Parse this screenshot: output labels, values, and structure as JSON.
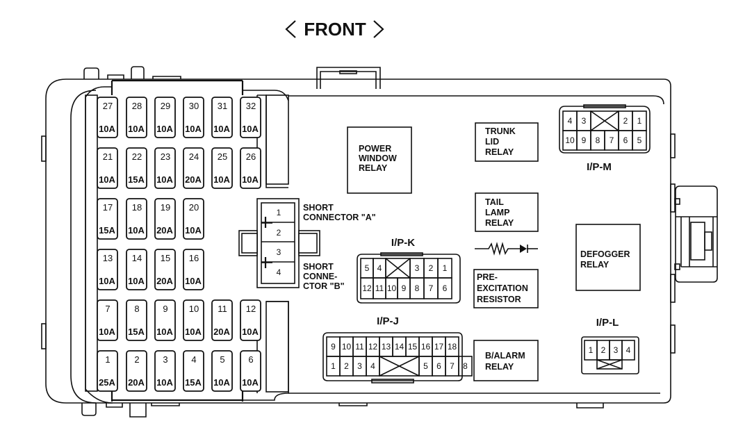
{
  "title": "FRONT",
  "fuses": [
    {
      "num": "27",
      "amp": "10A"
    },
    {
      "num": "28",
      "amp": "10A"
    },
    {
      "num": "29",
      "amp": "10A"
    },
    {
      "num": "30",
      "amp": "10A"
    },
    {
      "num": "31",
      "amp": "10A"
    },
    {
      "num": "32",
      "amp": "10A"
    },
    {
      "num": "21",
      "amp": "10A"
    },
    {
      "num": "22",
      "amp": "15A"
    },
    {
      "num": "23",
      "amp": "10A"
    },
    {
      "num": "24",
      "amp": "20A"
    },
    {
      "num": "25",
      "amp": "10A"
    },
    {
      "num": "26",
      "amp": "10A"
    },
    {
      "num": "17",
      "amp": "15A"
    },
    {
      "num": "18",
      "amp": "10A"
    },
    {
      "num": "19",
      "amp": "20A"
    },
    {
      "num": "20",
      "amp": "10A"
    },
    {
      "num": "13",
      "amp": "10A"
    },
    {
      "num": "14",
      "amp": "10A"
    },
    {
      "num": "15",
      "amp": "20A"
    },
    {
      "num": "16",
      "amp": "10A"
    },
    {
      "num": "7",
      "amp": "10A"
    },
    {
      "num": "8",
      "amp": "15A"
    },
    {
      "num": "9",
      "amp": "10A"
    },
    {
      "num": "10",
      "amp": "10A"
    },
    {
      "num": "11",
      "amp": "20A"
    },
    {
      "num": "12",
      "amp": "10A"
    },
    {
      "num": "1",
      "amp": "25A"
    },
    {
      "num": "2",
      "amp": "20A"
    },
    {
      "num": "3",
      "amp": "10A"
    },
    {
      "num": "4",
      "amp": "15A"
    },
    {
      "num": "5",
      "amp": "10A"
    },
    {
      "num": "6",
      "amp": "10A"
    }
  ],
  "short_connector": {
    "pins": [
      "1",
      "2",
      "3",
      "4"
    ],
    "label_a": [
      "SHORT",
      "CONNECTOR \"A\""
    ],
    "label_b": [
      "SHORT",
      "CONNE-",
      "CTOR \"B\""
    ]
  },
  "relays": {
    "power_window": [
      "POWER",
      "WINDOW",
      "RELAY"
    ],
    "trunk_lid": [
      "TRUNK",
      "LID",
      "RELAY"
    ],
    "tail_lamp": [
      "TAIL",
      "LAMP",
      "RELAY"
    ],
    "pre_excitation": [
      "PRE-",
      "EXCITATION",
      "RESISTOR"
    ],
    "b_alarm": [
      "B/ALARM",
      "RELAY"
    ],
    "defogger": [
      "DEFOGGER",
      "RELAY"
    ]
  },
  "connectors": {
    "ip_k": {
      "name": "I/P-K",
      "top": [
        "5",
        "4",
        "",
        "3",
        "2",
        "1"
      ],
      "bottom": [
        "12",
        "11",
        "10",
        "9",
        "8",
        "7",
        "6"
      ]
    },
    "ip_j": {
      "name": "I/P-J",
      "top": [
        "9",
        "10",
        "11",
        "12",
        "13",
        "14",
        "15",
        "16",
        "17",
        "18"
      ],
      "bottom": [
        "1",
        "2",
        "3",
        "4",
        "",
        "5",
        "6",
        "7",
        "8"
      ]
    },
    "ip_m": {
      "name": "I/P-M",
      "top": [
        "4",
        "3",
        "",
        "2",
        "1"
      ],
      "bottom": [
        "10",
        "9",
        "8",
        "7",
        "6",
        "5"
      ]
    },
    "ip_l": {
      "name": "I/P-L",
      "top": [
        "1",
        "2",
        "3",
        "4"
      ]
    }
  },
  "symbols": [
    "resistor-icon",
    "diode-icon"
  ]
}
